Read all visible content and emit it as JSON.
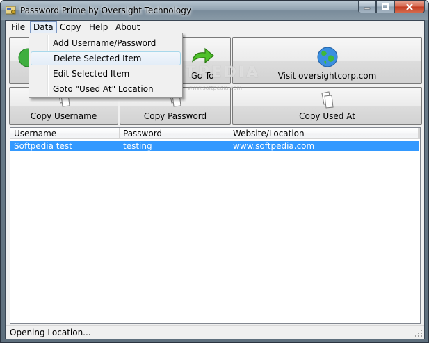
{
  "window": {
    "title": "Password Prime by Oversight Technology"
  },
  "menubar": {
    "items": [
      "File",
      "Data",
      "Copy",
      "Help",
      "About"
    ],
    "active": "Data"
  },
  "data_menu": {
    "items": [
      "Add Username/Password",
      "Delete Selected Item",
      "Edit Selected Item",
      "Goto \"Used At\" Location"
    ],
    "highlighted": "Delete Selected Item"
  },
  "toolbar": {
    "go_to_label": "Go To",
    "visit_label": "Visit oversightcorp.com",
    "copy_username_label": "Copy Username",
    "copy_password_label": "Copy Password",
    "copy_used_at_label": "Copy Used At"
  },
  "list": {
    "columns": [
      "Username",
      "Password",
      "Website/Location"
    ],
    "rows": [
      {
        "username": "Softpedia test",
        "password": "testing",
        "website": "www.softpedia.com",
        "selected": true
      }
    ]
  },
  "status": {
    "text": "Opening Location..."
  },
  "watermark": {
    "text": "SOFTPEDIA",
    "sub": "www.softpedia.com"
  },
  "icons": {
    "app": "app-key-icon",
    "go_to": "green-arrow-icon",
    "visit": "globe-icon",
    "copy": "copy-pages-icon"
  },
  "colors": {
    "selection": "#3399ff",
    "menu_hover": "#e3edf8"
  }
}
